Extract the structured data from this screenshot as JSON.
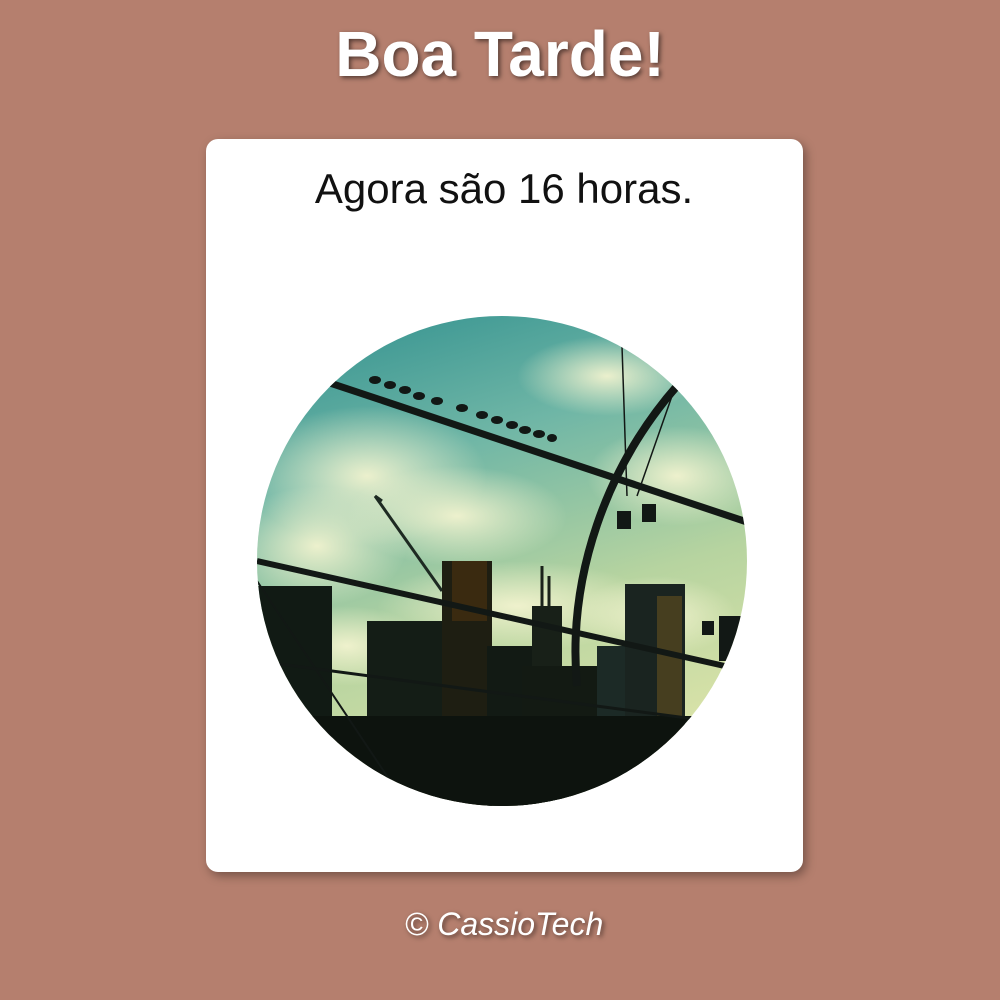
{
  "header": {
    "title": "Boa Tarde!"
  },
  "card": {
    "time_text": "Agora são 16 horas.",
    "image": "afternoon-city-skyline-photo"
  },
  "footer": {
    "copyright": "© CassioTech"
  },
  "colors": {
    "background": "#b57f6e",
    "card": "#ffffff",
    "title": "#ffffff",
    "text": "#111111"
  }
}
